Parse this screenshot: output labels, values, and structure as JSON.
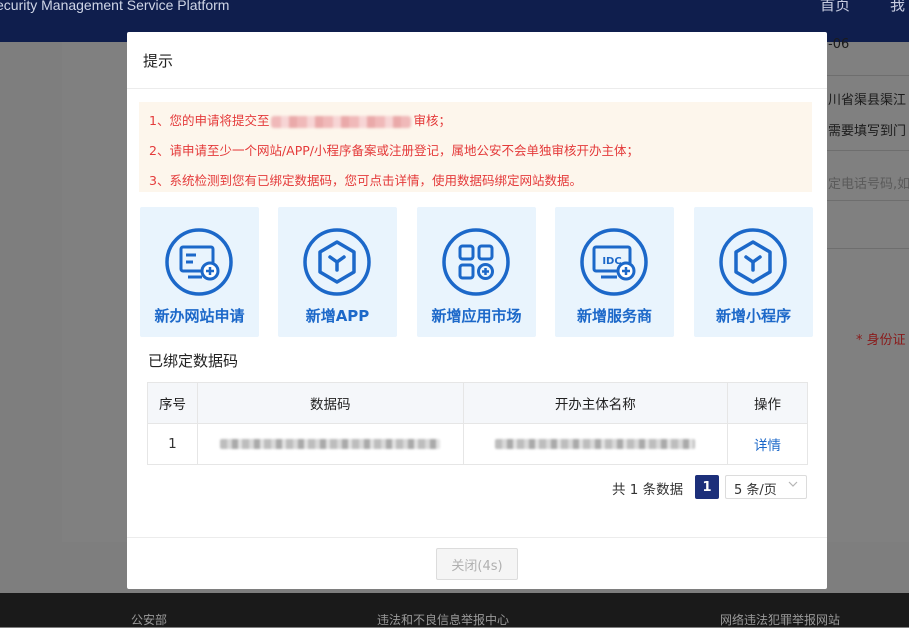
{
  "background": {
    "platform_title": "ecurity Management Service Platform",
    "nav": [
      "首页",
      "我"
    ],
    "side_texts": [
      {
        "text": "-06"
      },
      {
        "text": "川省渠县渠江"
      },
      {
        "text": "需要填写到门"
      },
      {
        "text": "定电话号码,如"
      }
    ],
    "id_label": "* 身份证",
    "footer": [
      "公安部",
      "违法和不良信息举报中心",
      "网络违法犯罪举报网站"
    ]
  },
  "modal": {
    "title": "提示",
    "notices": [
      {
        "prefix": "1、您的申请将提交至",
        "suffix": "审核；"
      },
      {
        "text": "2、请申请至少一个网站/APP/小程序备案或注册登记，属地公安不会单独审核开办主体；"
      },
      {
        "text": "3、系统检测到您有已绑定数据码，您可点击详情，使用数据码绑定网站数据。"
      }
    ],
    "cards": [
      {
        "label": "新办网站申请",
        "icon": "website-add-icon"
      },
      {
        "label": "新增APP",
        "icon": "cube-icon"
      },
      {
        "label": "新增应用市场",
        "icon": "app-market-icon"
      },
      {
        "label": "新增服务商",
        "icon": "idc-icon"
      },
      {
        "label": "新增小程序",
        "icon": "cube-icon"
      }
    ],
    "bound_section_title": "已绑定数据码",
    "table": {
      "headers": [
        "序号",
        "数据码",
        "开办主体名称",
        "操作"
      ],
      "rows": [
        {
          "index": "1",
          "action": "详情"
        }
      ]
    },
    "pagination": {
      "total_text": "共 1 条数据",
      "current_page": "1",
      "page_size": "5 条/页"
    },
    "close_button": "关闭(4s)"
  },
  "colors": {
    "primary": "#1c68c9",
    "notice_red": "#e43a3a",
    "notice_bg": "#fdf6ec",
    "card_bg": "#e9f4fd",
    "header_bg": "#0f1e4d"
  }
}
